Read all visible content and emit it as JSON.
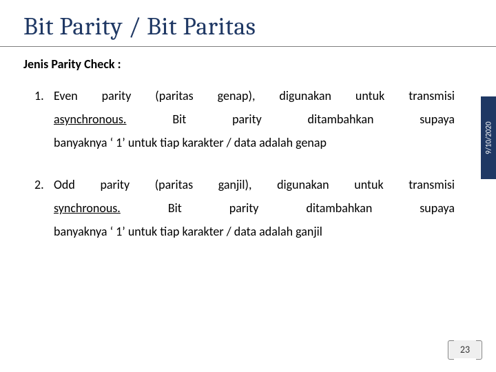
{
  "title": "Bit Parity / Bit Paritas",
  "subheading": "Jenis Parity Check :",
  "items": [
    {
      "line1_a": "Even parity (paritas genap), digunakan untuk transmisi",
      "line2_u": "asynchronous.",
      "line2_b": "Bit parity ditambahkan supaya",
      "line3": "banyaknya ‘ 1’ untuk tiap karakter / data adalah genap"
    },
    {
      "line1_a": "Odd parity (paritas ganjil), digunakan untuk transmisi",
      "line2_u": "synchronous.",
      "line2_b": "Bit parity ditambahkan supaya",
      "line3": "banyaknya ‘ 1’ untuk tiap karakter / data adalah ganjil"
    }
  ],
  "date": "9/10/2020",
  "page_number": "23"
}
